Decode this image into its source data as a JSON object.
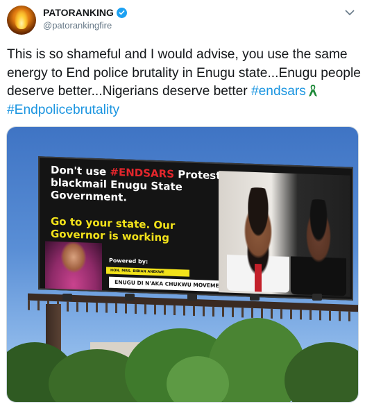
{
  "user": {
    "display_name": "PATORANKING",
    "handle": "@patorankingfire",
    "verified": true
  },
  "tweet": {
    "text_part1": "This is so shameful and I would advise, you use the same energy to End police brutality in Enugu state...Enugu people deserve better...Nigerians deserve better ",
    "hashtag1": "#endsars",
    "hashtag2": "#Endpolicebrutality",
    "emoji": "ribbon-emoji-green-white"
  },
  "billboard": {
    "headline_part1": "Don't use ",
    "headline_red": "#ENDSARS",
    "headline_part2": " Protest to blackmail Enugu State Government.",
    "subline": "Go to your state. Our Governor is working",
    "powered_by": "Powered by:",
    "hon": "HON. MRS. BIBIAN ANEKWE",
    "movement": "ENUGU DI N'AKA CHUKWU MOVEMENT (DG)"
  },
  "colors": {
    "hashtag": "#1b95e0",
    "verified": "#1da1f2",
    "billboard_red": "#e3262c",
    "billboard_yellow": "#f2e21a"
  }
}
